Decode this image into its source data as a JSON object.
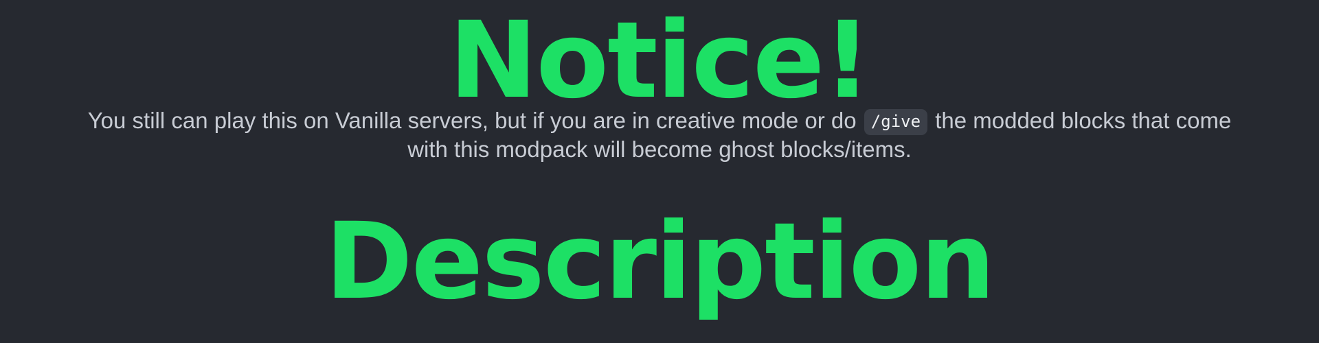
{
  "notice": {
    "title": "Notice!",
    "text_before_code": "You still can play this on Vanilla servers, but if you are in creative mode or do ",
    "code": "/give",
    "text_after_code": " the modded blocks that come",
    "second_line": "with this modpack will become ghost blocks/items."
  },
  "description": {
    "title": "Description"
  },
  "colors": {
    "background": "#262930",
    "heading": "#1de065",
    "body_text": "#c8ccd4",
    "code_background": "#3b3f48"
  }
}
